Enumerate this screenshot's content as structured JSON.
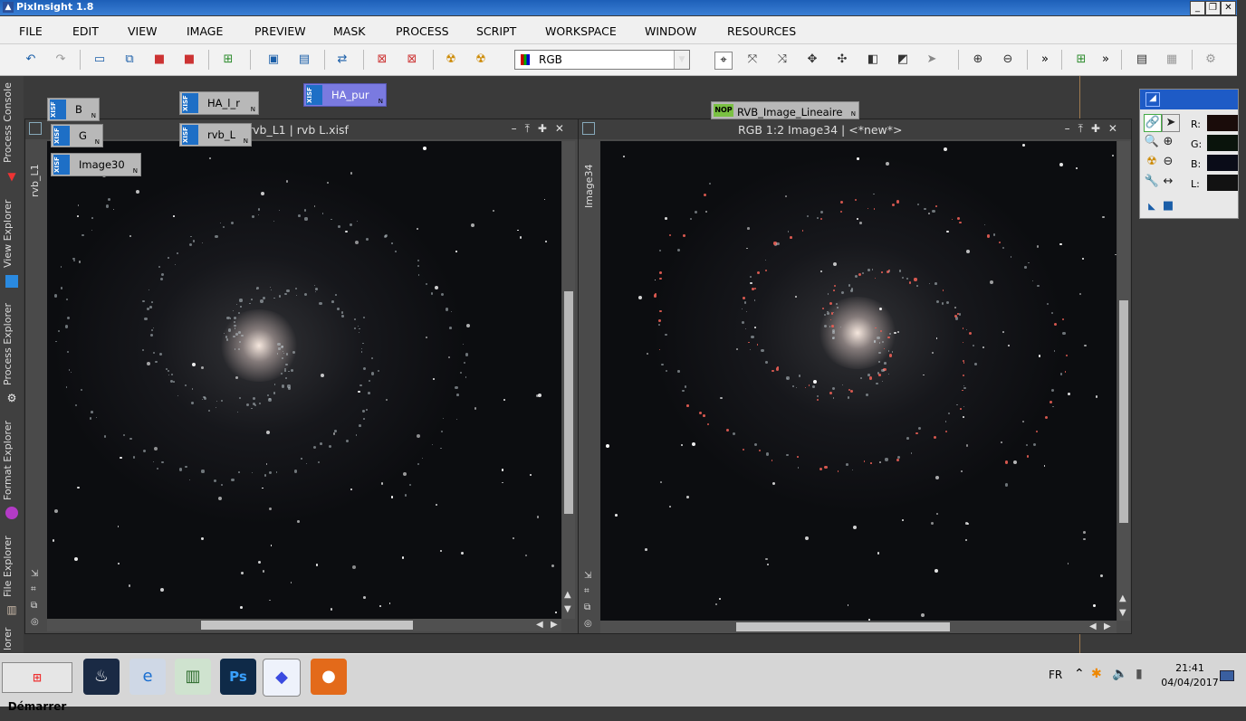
{
  "app": {
    "title": "PixInsight 1.8"
  },
  "menu": [
    "FILE",
    "EDIT",
    "VIEW",
    "IMAGE",
    "PREVIEW",
    "MASK",
    "PROCESS",
    "SCRIPT",
    "WORKSPACE",
    "WINDOW",
    "RESOURCES"
  ],
  "toolbar": {
    "channel_select": "RGB",
    "more": "»"
  },
  "side_tabs": [
    "Process Console",
    "View Explorer",
    "Process Explorer",
    "Format Explorer",
    "File Explorer",
    "lorer"
  ],
  "icons": [
    {
      "name": "B",
      "badge": "XISF"
    },
    {
      "name": "G",
      "badge": "XISF"
    },
    {
      "name": "Image30",
      "badge": "XISF"
    },
    {
      "name": "HA_l_r",
      "badge": "XISF"
    },
    {
      "name": "rvb_L",
      "badge": "XISF"
    },
    {
      "name": "HA_pur",
      "badge": "XISF"
    },
    {
      "name": "RVB_Image_Lineaire",
      "badge": "NOP"
    }
  ],
  "icon_n": "N",
  "window1": {
    "title": "rvb_L1 | rvb L.xisf",
    "side_label": "rvb_L1"
  },
  "window2": {
    "title": "RGB 1:2 Image34 | <*new*>",
    "side_label": "Image34"
  },
  "readout": {
    "r": "R:",
    "g": "G:",
    "b": "B:",
    "l": "L:"
  },
  "taskbar": {
    "start": "Démarrer",
    "lang": "FR",
    "time": "21:41",
    "date": "04/04/2017"
  },
  "colors": {
    "titlebar": "#1d5fb8",
    "workspace": "#3a3a3a",
    "xisf_badge": "#1e6fc6",
    "nop_badge": "#7ac142",
    "selected_icon": "#7a7ae0"
  }
}
